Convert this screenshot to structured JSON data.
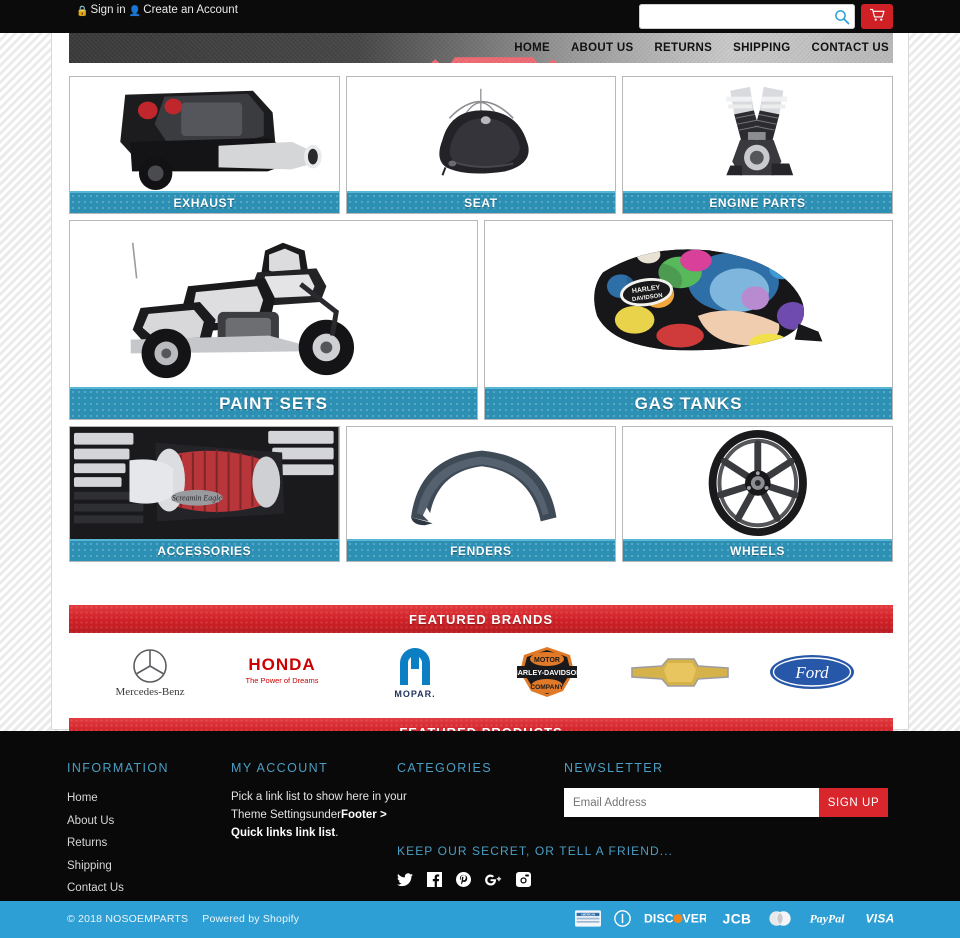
{
  "topbar": {
    "sign_in": "Sign in",
    "sign_in_icon": "lock-icon",
    "create_account": "Create an Account",
    "create_account_icon": "user-icon",
    "search_placeholder": "",
    "search_value": "",
    "search_icon": "search-icon",
    "cart_icon": "shopping-cart-icon"
  },
  "nav": {
    "items": [
      {
        "label": "HOME"
      },
      {
        "label": "ABOUT US"
      },
      {
        "label": "RETURNS"
      },
      {
        "label": "SHIPPING"
      },
      {
        "label": "CONTACT US"
      }
    ]
  },
  "categories": {
    "row1": [
      {
        "label": "EXHAUST",
        "art": "motorcycle-exhaust"
      },
      {
        "label": "SEAT",
        "art": "motorcycle-seat"
      },
      {
        "label": "ENGINE PARTS",
        "art": "engine-block"
      }
    ],
    "row2": [
      {
        "label": "PAINT SETS",
        "art": "motorcycle-full"
      },
      {
        "label": "GAS TANKS",
        "art": "painted-gas-tank"
      }
    ],
    "row3": [
      {
        "label": "ACCESSORIES",
        "art": "air-cleaner"
      },
      {
        "label": "FENDERS",
        "art": "fender"
      },
      {
        "label": "WHEELS",
        "art": "wheel"
      }
    ]
  },
  "sections": {
    "featured_brands": "FEATURED BRANDS",
    "featured_products": "FEATURED PRODUCTS"
  },
  "brands": [
    {
      "name": "Mercedes-Benz",
      "logo": "mercedes-benz-logo"
    },
    {
      "name": "HONDA",
      "tagline": "The Power of Dreams",
      "logo": "honda-logo"
    },
    {
      "name": "MOPAR",
      "logo": "mopar-logo"
    },
    {
      "name": "HARLEY-DAVIDSON",
      "top": "MOTOR",
      "bottom": "COMPANY",
      "logo": "harley-davidson-logo"
    },
    {
      "name": "Chevrolet",
      "logo": "chevrolet-bowtie-logo"
    },
    {
      "name": "Ford",
      "logo": "ford-logo"
    }
  ],
  "footer": {
    "information": {
      "title": "INFORMATION",
      "links": [
        {
          "label": "Home"
        },
        {
          "label": "About Us"
        },
        {
          "label": "Returns"
        },
        {
          "label": "Shipping"
        },
        {
          "label": "Contact Us"
        }
      ]
    },
    "my_account": {
      "title": "MY  ACCOUNT",
      "note_1": "Pick a link list to show here in your",
      "note_2": "Theme Settings",
      "note_3": "under",
      "note_4": "Footer >",
      "note_5": "Quick links link list",
      "note_6": "."
    },
    "categories": {
      "title": "CATEGORIES"
    },
    "newsletter": {
      "title": "NEWSLETTER",
      "placeholder": "Email Address",
      "value": "",
      "button": "SIGN UP"
    },
    "tagline": "KEEP OUR SECRET, OR TELL A FRIEND...",
    "socials": [
      {
        "name": "twitter-icon"
      },
      {
        "name": "facebook-icon"
      },
      {
        "name": "pinterest-icon"
      },
      {
        "name": "google-plus-icon"
      },
      {
        "name": "instagram-icon"
      }
    ]
  },
  "bottom": {
    "copyright": "© 2018 NOSOEMPARTS",
    "powered_by": "Powered by Shopify",
    "payments": [
      {
        "name": "american-express-icon",
        "label": "AMERICAN EXPRESS"
      },
      {
        "name": "diners-club-icon",
        "label": "Diners Club"
      },
      {
        "name": "discover-icon",
        "label": "DISCOVER"
      },
      {
        "name": "jcb-icon",
        "label": "JCB"
      },
      {
        "name": "mastercard-icon",
        "label": "Mastercard"
      },
      {
        "name": "paypal-icon",
        "label": "PayPal"
      },
      {
        "name": "visa-icon",
        "label": "VISA"
      }
    ]
  },
  "colors": {
    "accent_blue": "#2e9fd4",
    "tile_caption": "#2c8fb4",
    "red": "#cf2026",
    "footer_bg": "#090909",
    "link_blue": "#4b9ec4"
  }
}
